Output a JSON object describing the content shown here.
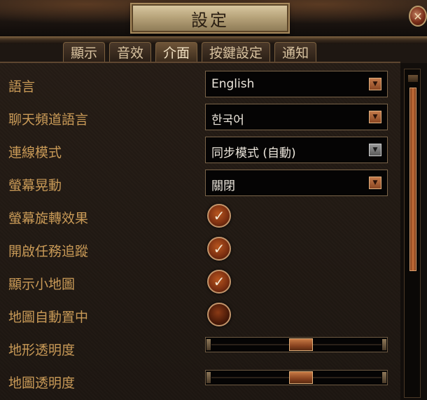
{
  "window": {
    "title": "設定",
    "close_icon": "close-icon"
  },
  "tabs": [
    {
      "label": "顯示",
      "active": false
    },
    {
      "label": "音效",
      "active": false
    },
    {
      "label": "介面",
      "active": true
    },
    {
      "label": "按鍵設定",
      "active": false
    },
    {
      "label": "通知",
      "active": false
    }
  ],
  "settings": {
    "language": {
      "label": "語言",
      "value": "English"
    },
    "chat_language": {
      "label": "聊天頻道語言",
      "value": "한국어"
    },
    "connection_mode": {
      "label": "連線模式",
      "value": "同步模式 (自動)",
      "disabled": true
    },
    "screen_shake": {
      "label": "螢幕晃動",
      "value": "關閉"
    },
    "screen_rotation": {
      "label": "螢幕旋轉效果",
      "checked": true
    },
    "quest_tracker": {
      "label": "開啟任務追蹤",
      "checked": true
    },
    "minimap": {
      "label": "顯示小地圖",
      "checked": true
    },
    "map_autocenter": {
      "label": "地圖自動置中",
      "checked": false
    },
    "terrain_transparency": {
      "label": "地形透明度",
      "level": 0.53
    },
    "map_transparency": {
      "label": "地圖透明度",
      "level": 0.53
    }
  },
  "scrollbar": {
    "position": 0.0
  },
  "colors": {
    "label": "#c99a57",
    "accent": "#c77a44"
  }
}
